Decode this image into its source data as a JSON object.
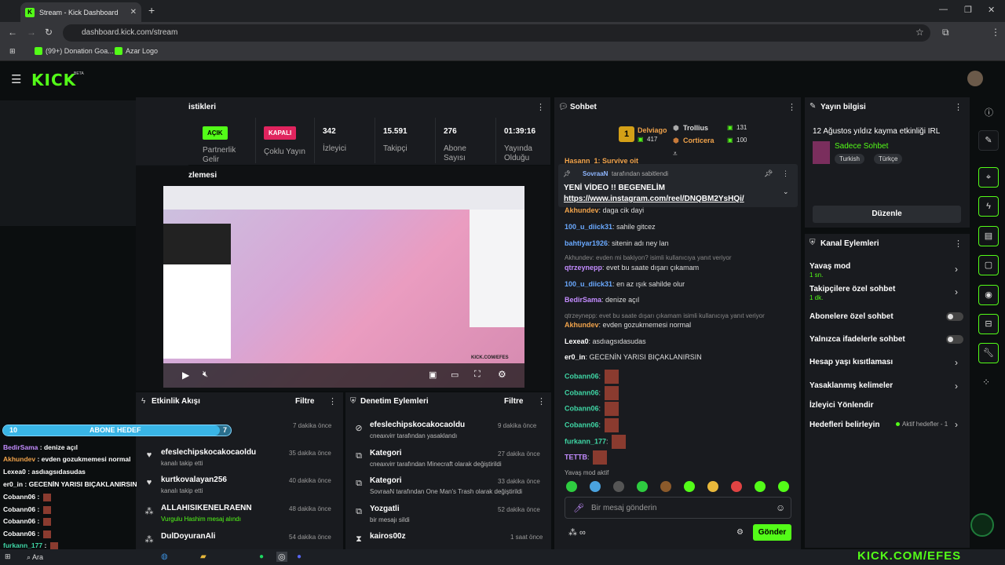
{
  "browser": {
    "tab_title": "Stream - Kick Dashboard",
    "url": "dashboard.kick.com/stream",
    "bookmarks": [
      "(99+) Donation Goa...",
      "Azar Logo"
    ]
  },
  "brand": {
    "logo": "KICK",
    "beta": "BETA",
    "accent": "#53fc18"
  },
  "stats": {
    "title": "istikleri",
    "partner_badge": "AÇIK",
    "partner_label": "Partnerlik Gelir",
    "multi_badge": "KAPALI",
    "multi_label": "Çoklu Yayın",
    "viewers_value": "342",
    "viewers_label": "İzleyici",
    "followers_value": "15.591",
    "followers_label": "Takipçi",
    "subs_value": "276",
    "subs_label": "Abone Sayısı",
    "uptime_value": "01:39:16",
    "uptime_label": "Yayında Olduğu"
  },
  "preview": {
    "title": "zlemesi",
    "watermark": "KICK.COM/EFES"
  },
  "chat": {
    "title": "Sohbet",
    "leaders": [
      {
        "name": "Delviago",
        "count": "417"
      },
      {
        "name": "Trollius",
        "count": "131"
      },
      {
        "name": "Corticera",
        "count": "100"
      }
    ],
    "rank": "1",
    "pinned_by": "SovraaN",
    "pinned_suffix": "tarafından sabitlendi",
    "pinned_text": "YENİ VİDEO !! BEGENELİM",
    "pinned_link": "https://www.instagram.com/reel/DNQBM2YsHQi/",
    "top_cut": "Hasann_1: Survive oit",
    "messages": [
      {
        "user": "Akhundev",
        "color": "#f1a34b",
        "text": "daga cik dayi"
      },
      {
        "user": "100_u_diick31",
        "color": "#6aa9ff",
        "text": "sahile gitcez"
      },
      {
        "user": "bahtiyar1926",
        "color": "#6aa9ff",
        "text": "sitenin adı ney lan"
      },
      {
        "reply": "Akhundev: evden mi bakiyon? isimli kullanıcıya yanıt veriyor"
      },
      {
        "user": "qtrzeynepp",
        "color": "#c38cff",
        "text": "evet bu saate dışarı çıkamam"
      },
      {
        "user": "100_u_diick31",
        "color": "#6aa9ff",
        "text": "en az ışık sahilde olur"
      },
      {
        "user": "BedirSama",
        "color": "#c38cff",
        "text": "denize açıl"
      },
      {
        "reply": "qtrzeynepp: evet bu saate dışarı çıkamam isimli kullanıcıya yanıt veriyor"
      },
      {
        "user": "Akhundev",
        "color": "#f1a34b",
        "text": "evden gozukmemesi normal"
      },
      {
        "user": "Lexea0",
        "color": "#ffffff",
        "text": "asdıagsıdasudas"
      },
      {
        "user": "er0_in",
        "color": "#ffffff",
        "text": "GECENİN YARISI BIÇAKLANIRSIN"
      },
      {
        "user": "Cobann06",
        "color": "#3fd6a5",
        "text": ""
      },
      {
        "user": "Cobann06",
        "color": "#3fd6a5",
        "text": ""
      },
      {
        "user": "Cobann06",
        "color": "#3fd6a5",
        "text": ""
      },
      {
        "user": "Cobann06",
        "color": "#3fd6a5",
        "text": ""
      },
      {
        "user": "furkann_177",
        "color": "#3fd6a5",
        "text": ""
      },
      {
        "user": "TETTB",
        "color": "#c38cff",
        "text": ""
      }
    ],
    "slow_mode": "Yavaş mod aktif",
    "input_placeholder": "Bir mesaj gönderin",
    "send_label": "Gönder"
  },
  "stream_info": {
    "title": "Yayın bilgisi",
    "stream_title": "12 Ağustos yıldız kayma etkinliği IRL",
    "category": "Sadece Sohbet",
    "tags": [
      "Turkish",
      "Türkçe"
    ],
    "edit_label": "Düzenle"
  },
  "channel_actions": {
    "title": "Kanal Eylemleri",
    "items": [
      {
        "label": "Yavaş mod",
        "sub": "1 sn.",
        "kind": "chev"
      },
      {
        "label": "Takipçilere özel sohbet",
        "sub": "1 dk.",
        "kind": "chev"
      },
      {
        "label": "Abonelere özel sohbet",
        "kind": "toggle"
      },
      {
        "label": "Yalnızca ifadelerle sohbet",
        "kind": "toggle"
      },
      {
        "label": "Hesap yaşı kısıtlaması",
        "kind": "chev"
      },
      {
        "label": "Yasaklanmış kelimeler",
        "kind": "chev"
      },
      {
        "label": "İzleyici Yönlendir",
        "kind": "none"
      },
      {
        "label": "Hedefleri belirleyin",
        "kind": "goal",
        "extra": "Aktif hedefler - 1"
      }
    ]
  },
  "activity": {
    "title": "Etkinlik Akışı",
    "filter": "Filtre",
    "items": [
      {
        "name": "",
        "desc": "",
        "time": "7 dakika önce"
      },
      {
        "name": "efeslechipskocakocaoldu",
        "desc": "kanalı takip etti",
        "time": "35 dakika önce"
      },
      {
        "name": "kurtkovalayan256",
        "desc": "kanalı takip etti",
        "time": "40 dakika önce"
      },
      {
        "name": "ALLAHISIKENELRAENN",
        "desc": "Vurgulu Hashim mesaj alındı",
        "time": "48 dakika önce"
      },
      {
        "name": "DulDoyuranAli",
        "desc": "",
        "time": "54 dakika önce"
      }
    ]
  },
  "moderation": {
    "title": "Denetim Eylemleri",
    "filter": "Filtre",
    "items": [
      {
        "name": "efeslechipskocakocaoldu",
        "desc": "cneaxvirr tarafından yasaklandı",
        "time": "9 dakika önce"
      },
      {
        "name": "Kategori",
        "desc": "cneaxvirr tarafından Minecraft olarak değiştirildi",
        "time": "27 dakika önce"
      },
      {
        "name": "Kategori",
        "desc": "SovraaN tarafından One Man's Trash olarak değiştirildi",
        "time": "33 dakika önce"
      },
      {
        "name": "Yozgatli",
        "desc": "bir mesajı sildi",
        "time": "52 dakika önce"
      },
      {
        "name": "kairos00z",
        "desc": "",
        "time": "1 saat önce"
      }
    ]
  },
  "overlay": {
    "goal_left": "10",
    "goal_label": "ABONE HEDEF",
    "goal_right": "7",
    "goal_progress": 0.95,
    "lines": [
      {
        "user": "BedirSama",
        "color": "#c38cff",
        "text": "denize açıl"
      },
      {
        "user": "Akhundev",
        "color": "#f1a34b",
        "text": "evden gozukmemesi normal"
      },
      {
        "user": "Lexea0",
        "color": "#ffffff",
        "text": "asdıagsıdasudas"
      },
      {
        "user": "er0_in",
        "color": "#ffffff",
        "text": "GECENİN YARISI BIÇAKLANIRSIN"
      },
      {
        "user": "Cobann06",
        "color": "#ffffff",
        "text": ""
      },
      {
        "user": "Cobann06",
        "color": "#ffffff",
        "text": ""
      },
      {
        "user": "Cobann06",
        "color": "#ffffff",
        "text": ""
      },
      {
        "user": "Cobann06",
        "color": "#ffffff",
        "text": ""
      },
      {
        "user": "furkann_177",
        "color": "#3fd6a5",
        "text": ""
      }
    ],
    "watermark": "KICK.COM/EFES"
  },
  "taskbar": {
    "search": "Ara"
  }
}
